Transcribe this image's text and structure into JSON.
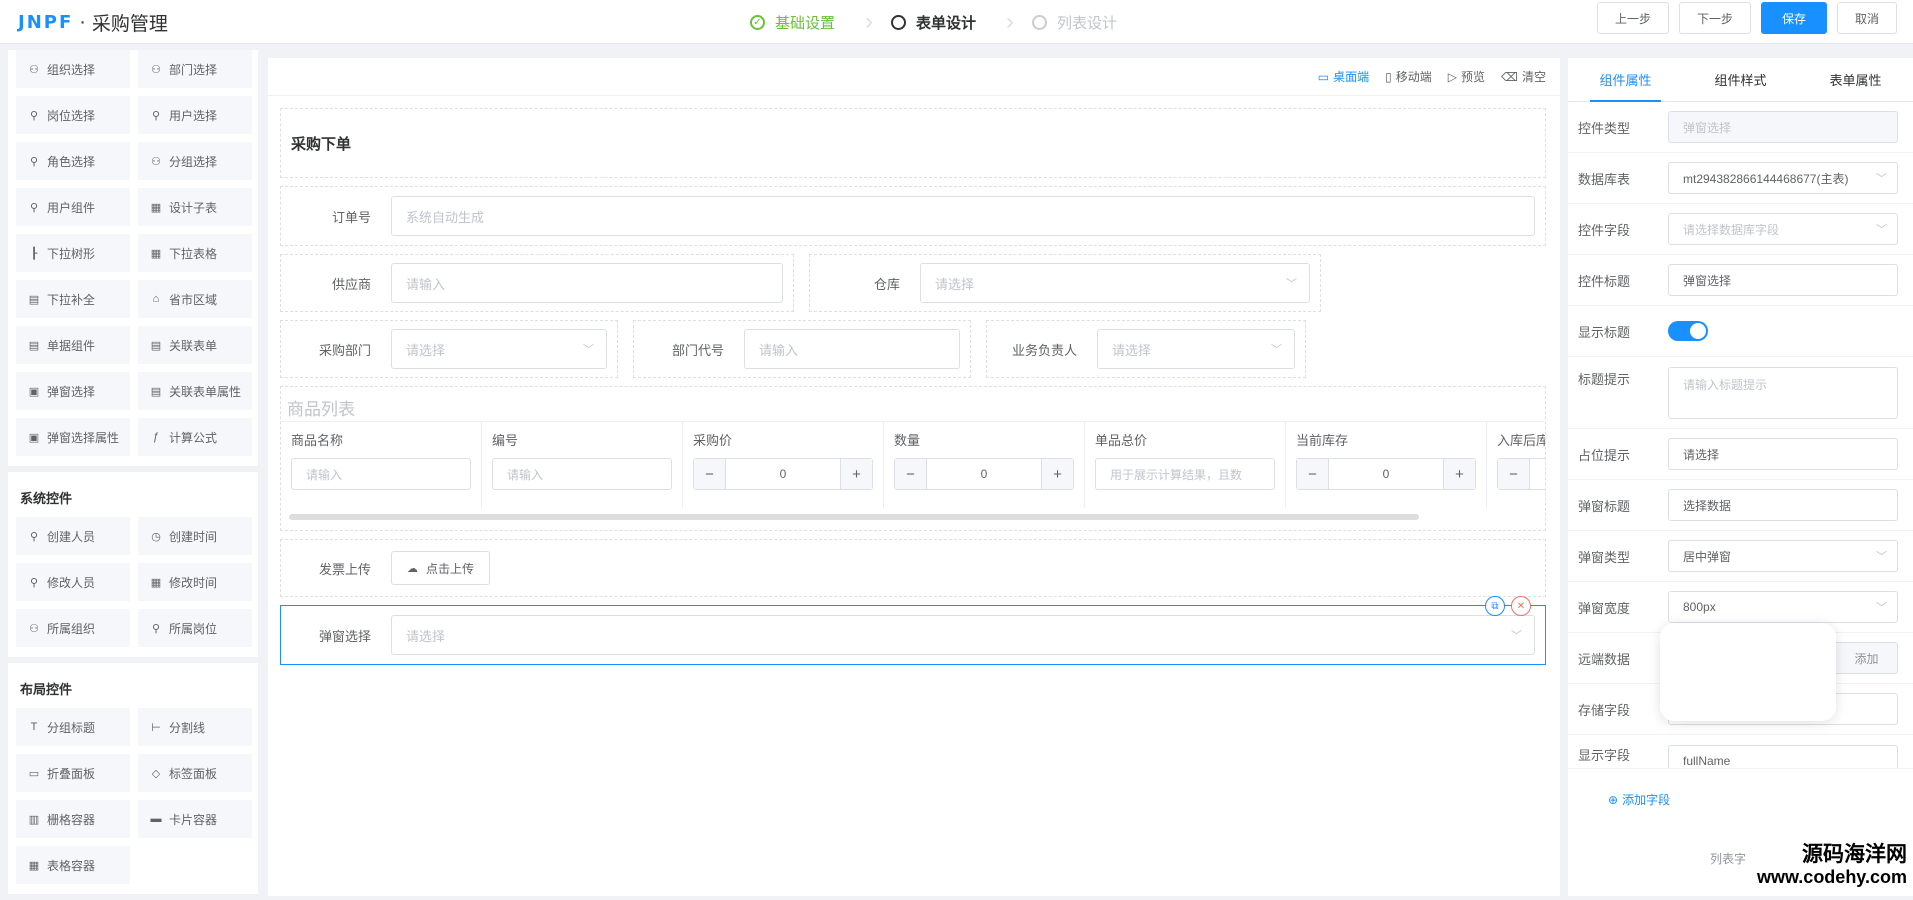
{
  "header": {
    "brand": "JNPF",
    "separator": "·",
    "title": "采购管理",
    "steps": [
      {
        "label": "基础设置",
        "state": "done"
      },
      {
        "label": "表单设计",
        "state": "active"
      },
      {
        "label": "列表设计",
        "state": "todo"
      }
    ],
    "buttons": {
      "prev": "上一步",
      "next": "下一步",
      "save": "保存",
      "cancel": "取消"
    }
  },
  "left": {
    "top_items": [
      {
        "label": "组织选择",
        "icon": "org-icon"
      },
      {
        "label": "部门选择",
        "icon": "dept-icon"
      },
      {
        "label": "岗位选择",
        "icon": "post-icon"
      },
      {
        "label": "用户选择",
        "icon": "user-icon"
      },
      {
        "label": "角色选择",
        "icon": "role-icon"
      },
      {
        "label": "分组选择",
        "icon": "group-icon"
      },
      {
        "label": "用户组件",
        "icon": "user-icon"
      },
      {
        "label": "设计子表",
        "icon": "table-icon"
      },
      {
        "label": "下拉树形",
        "icon": "tree-icon"
      },
      {
        "label": "下拉表格",
        "icon": "table-icon"
      },
      {
        "label": "下拉补全",
        "icon": "autocomplete-icon"
      },
      {
        "label": "省市区域",
        "icon": "location-icon"
      },
      {
        "label": "单据组件",
        "icon": "doc-icon"
      },
      {
        "label": "关联表单",
        "icon": "link-form-icon"
      },
      {
        "label": "弹窗选择",
        "icon": "popup-icon"
      },
      {
        "label": "关联表单属性",
        "icon": "link-attr-icon"
      },
      {
        "label": "弹窗选择属性",
        "icon": "popup-attr-icon"
      },
      {
        "label": "计算公式",
        "icon": "formula-icon"
      }
    ],
    "system_title": "系统控件",
    "system_items": [
      {
        "label": "创建人员",
        "icon": "user-icon"
      },
      {
        "label": "创建时间",
        "icon": "clock-icon"
      },
      {
        "label": "修改人员",
        "icon": "user-edit-icon"
      },
      {
        "label": "修改时间",
        "icon": "calendar-icon"
      },
      {
        "label": "所属组织",
        "icon": "org-icon"
      },
      {
        "label": "所属岗位",
        "icon": "post-icon"
      }
    ],
    "layout_title": "布局控件",
    "layout_items": [
      {
        "label": "分组标题",
        "icon": "text-icon"
      },
      {
        "label": "分割线",
        "icon": "divider-icon"
      },
      {
        "label": "折叠面板",
        "icon": "collapse-icon"
      },
      {
        "label": "标签面板",
        "icon": "tag-icon"
      },
      {
        "label": "栅格容器",
        "icon": "grid-icon"
      },
      {
        "label": "卡片容器",
        "icon": "card-icon"
      },
      {
        "label": "表格容器",
        "icon": "table-icon"
      }
    ]
  },
  "toolbar": {
    "desktop": "桌面端",
    "mobile": "移动端",
    "preview": "预览",
    "clear": "清空"
  },
  "form": {
    "title": "采购下单",
    "order_no": {
      "label": "订单号",
      "placeholder": "系统自动生成"
    },
    "supplier": {
      "label": "供应商",
      "placeholder": "请输入"
    },
    "warehouse": {
      "label": "仓库",
      "placeholder": "请选择"
    },
    "dept": {
      "label": "采购部门",
      "placeholder": "请选择"
    },
    "dept_code": {
      "label": "部门代号",
      "placeholder": "请输入"
    },
    "owner": {
      "label": "业务负责人",
      "placeholder": "请选择"
    },
    "table": {
      "title": "商品列表",
      "columns": [
        {
          "header": "商品名称",
          "kind": "input",
          "placeholder": "请输入"
        },
        {
          "header": "编号",
          "kind": "input",
          "placeholder": "请输入"
        },
        {
          "header": "采购价",
          "kind": "stepper",
          "value": "0"
        },
        {
          "header": "数量",
          "kind": "stepper",
          "value": "0"
        },
        {
          "header": "单品总价",
          "kind": "input",
          "placeholder": "用于展示计算结果，且数"
        },
        {
          "header": "当前库存",
          "kind": "stepper",
          "value": "0"
        },
        {
          "header": "入库后库",
          "kind": "stepper",
          "value": ""
        }
      ]
    },
    "invoice": {
      "label": "发票上传",
      "button": "点击上传"
    },
    "popup_select": {
      "label": "弹窗选择",
      "placeholder": "请选择"
    }
  },
  "right": {
    "tabs": [
      "组件属性",
      "组件样式",
      "表单属性"
    ],
    "props": {
      "type": {
        "label": "控件类型",
        "value": "弹窗选择"
      },
      "db_table": {
        "label": "数据库表",
        "value": "mt294382866144468677(主表)"
      },
      "field": {
        "label": "控件字段",
        "value": "请选择数据库字段"
      },
      "title": {
        "label": "控件标题",
        "value": "弹窗选择"
      },
      "show_title": {
        "label": "显示标题",
        "value": "on"
      },
      "title_tip": {
        "label": "标题提示",
        "value": "请输入标题提示"
      },
      "placeholder": {
        "label": "占位提示",
        "value": "请选择"
      },
      "popup_title": {
        "label": "弹窗标题",
        "value": "选择数据"
      },
      "popup_type": {
        "label": "弹窗类型",
        "value": "居中弹窗"
      },
      "popup_width": {
        "label": "弹窗宽度",
        "value": "800px"
      },
      "remote": {
        "label": "远端数据",
        "button": "添加"
      },
      "store_field": {
        "label": "存储字段"
      },
      "show_field": {
        "label": "显示字段",
        "value": "fullName"
      }
    },
    "add_field": "添加字段",
    "list_label": "列表字"
  },
  "watermark": {
    "line1": "源码海洋网",
    "line2": "www.codehy.com"
  }
}
